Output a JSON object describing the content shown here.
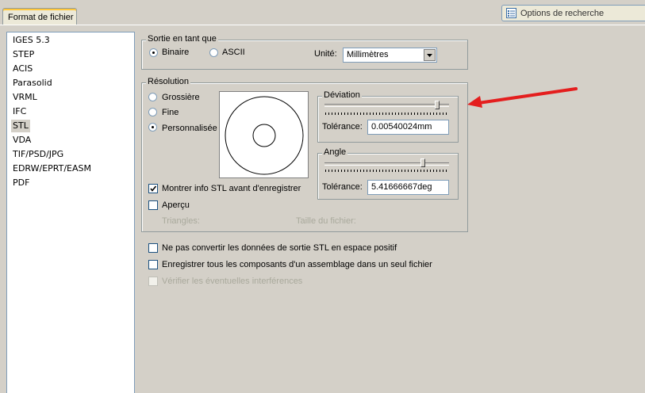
{
  "tab": {
    "label": "Format de fichier"
  },
  "search": {
    "label": "Options de recherche",
    "icon": "options-list-icon"
  },
  "formats": [
    "IGES 5.3",
    "STEP",
    "ACIS",
    "Parasolid",
    "VRML",
    "IFC",
    "STL",
    "VDA",
    "TIF/PSD/JPG",
    "EDRW/EPRT/EASM",
    "PDF"
  ],
  "selected_format": "STL",
  "output": {
    "title": "Sortie en tant que",
    "binary": "Binaire",
    "ascii": "ASCII",
    "selected": "Binaire",
    "unit_label": "Unité:",
    "unit_value": "Millimètres"
  },
  "resolution": {
    "title": "Résolution",
    "coarse": "Grossière",
    "fine": "Fine",
    "custom": "Personnalisée",
    "selected": "Personnalisée",
    "show_info": "Montrer info STL avant d'enregistrer",
    "show_info_checked": true,
    "preview": "Aperçu",
    "preview_checked": false,
    "triangles_label": "Triangles:",
    "filesize_label": "Taille du fichier:",
    "deviation": {
      "title": "Déviation",
      "tolerance_label": "Tolérance:",
      "tolerance_value": "0.00540024mm",
      "slider_level": 0.92
    },
    "angle": {
      "title": "Angle",
      "tolerance_label": "Tolérance:",
      "tolerance_value": "5.41666667deg",
      "slider_level": 0.8
    }
  },
  "options": {
    "no_positive_space": "Ne pas convertir les données de sortie STL en espace positif",
    "save_all_components": "Enregistrer tous les composants d'un assemblage dans un seul fichier",
    "check_interferences": "Vérifier les éventuelles interférences"
  },
  "annotation": {
    "arrow_color": "#e41e1e"
  }
}
